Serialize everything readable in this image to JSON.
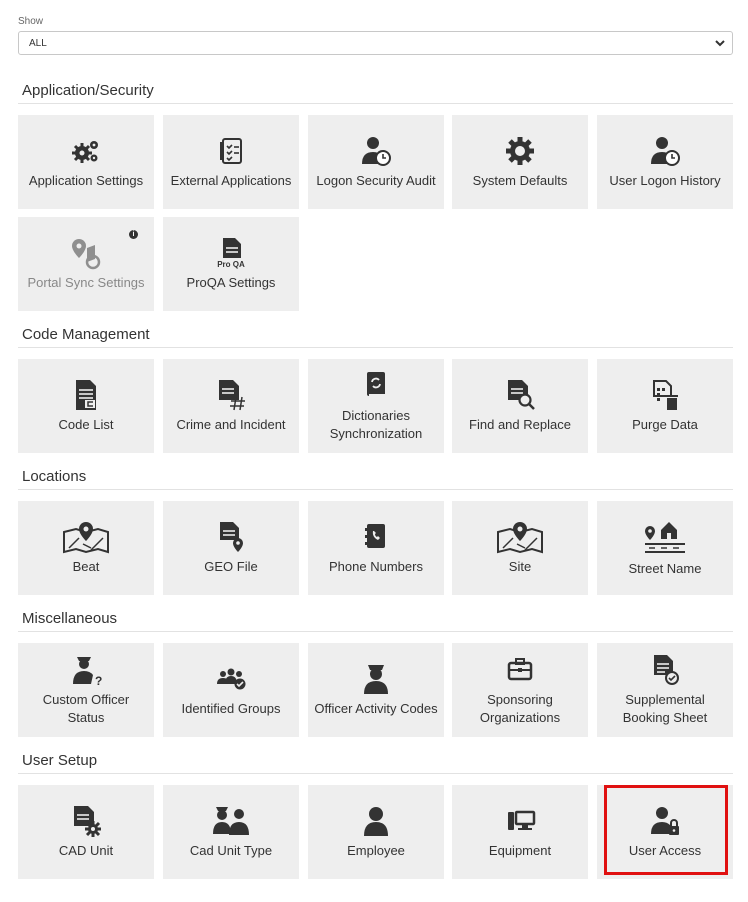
{
  "filter": {
    "label": "Show",
    "value": "ALL"
  },
  "sections": [
    {
      "title": "Application/Security",
      "tiles": [
        {
          "label": "Application Settings",
          "icon": "gears-icon"
        },
        {
          "label": "External Applications",
          "icon": "checklist-document-icon"
        },
        {
          "label": "Logon Security Audit",
          "icon": "user-clock-icon"
        },
        {
          "label": "System Defaults",
          "icon": "gear-icon"
        },
        {
          "label": "User Logon History",
          "icon": "user-clock-icon"
        },
        {
          "label": "Portal Sync Settings",
          "icon": "map-sync-icon",
          "info": "i"
        },
        {
          "label": "ProQA Settings",
          "icon": "proqa-document-icon",
          "icon_text": "Pro QA"
        }
      ]
    },
    {
      "title": "Code Management",
      "tiles": [
        {
          "label": "Code List",
          "icon": "document-list-icon"
        },
        {
          "label": "Crime and Incident",
          "icon": "document-hashtag-icon"
        },
        {
          "label": "Dictionaries Synchronization",
          "icon": "book-sync-icon"
        },
        {
          "label": "Find and Replace",
          "icon": "document-search-icon"
        },
        {
          "label": "Purge Data",
          "icon": "document-trash-icon"
        }
      ]
    },
    {
      "title": "Locations",
      "tiles": [
        {
          "label": "Beat",
          "icon": "map-pin-icon"
        },
        {
          "label": "GEO File",
          "icon": "document-pin-icon"
        },
        {
          "label": "Phone Numbers",
          "icon": "phone-book-icon"
        },
        {
          "label": "Site",
          "icon": "map-pin-icon"
        },
        {
          "label": "Street Name",
          "icon": "street-house-icon"
        }
      ]
    },
    {
      "title": "Miscellaneous",
      "tiles": [
        {
          "label": "Custom Officer Status",
          "icon": "officer-question-icon"
        },
        {
          "label": "Identified Groups",
          "icon": "group-check-icon"
        },
        {
          "label": "Officer Activity Codes",
          "icon": "officer-icon"
        },
        {
          "label": "Sponsoring Organizations",
          "icon": "briefcase-icon"
        },
        {
          "label": "Supplemental Booking Sheet",
          "icon": "document-check-icon"
        }
      ]
    },
    {
      "title": "User Setup",
      "tiles": [
        {
          "label": "CAD Unit",
          "icon": "document-gear-icon"
        },
        {
          "label": "Cad Unit Type",
          "icon": "officers-icon"
        },
        {
          "label": "Employee",
          "icon": "user-icon"
        },
        {
          "label": "Equipment",
          "icon": "computer-icon"
        },
        {
          "label": "User Access",
          "icon": "user-lock-icon"
        }
      ]
    }
  ],
  "colors": {
    "tile_bg": "#eeeeee",
    "icon": "#333333",
    "highlight": "#e01010"
  }
}
